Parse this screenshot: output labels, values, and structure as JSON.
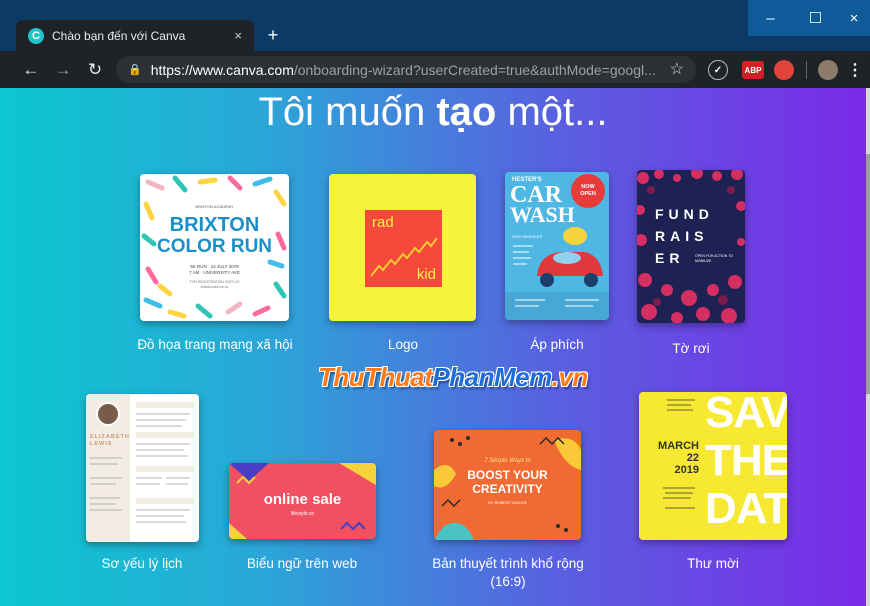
{
  "browser": {
    "tab_title": "Chào bạn đến với Canva",
    "tab_close": "×",
    "new_tab": "+",
    "url_host": "https://www.canva.com",
    "url_path": "/onboarding-wizard?userCreated=true&authMode=googl...",
    "window_min": "–",
    "window_max": "☐",
    "window_close": "×"
  },
  "page": {
    "heading_pre": "Tôi muốn ",
    "heading_bold": "tạo",
    "heading_post": " một..."
  },
  "watermark": {
    "part1": "ThuThuat",
    "part2": "PhanMem",
    "part3": ".vn"
  },
  "cards": {
    "social": {
      "label": "Đồ họa trang mạng xã hội",
      "small_top": "BRIXTON ACADEMY",
      "line1": "BRIXTON",
      "line2": "COLOR RUN",
      "meta1": "5K RUN · 22 JULY 2078",
      "meta2": "7 AM · UNIVERSITY AVE",
      "meta3": "FOR REGISTRATION VISIT US",
      "meta4": "brixtoncolorrun.co"
    },
    "logo": {
      "label": "Logo",
      "line1": "rad",
      "line2": "kid"
    },
    "poster": {
      "label": "Áp phích",
      "brand": "HESTER'S",
      "line1": "CAR",
      "line2": "WASH",
      "badge1": "NOW",
      "badge2": "OPEN",
      "small": "OUR SERVICES"
    },
    "flyer": {
      "label": "Tờ rơi",
      "line1": "FUND",
      "line2": "RAIS",
      "line3": "ER",
      "small": "OPEN FOR ACTION TO MOBILIZE"
    },
    "resume": {
      "label": "Sơ yếu lý lịch",
      "name1": "ELIZABETH",
      "name2": "LEWIS"
    },
    "banner": {
      "label": "Biểu ngữ trên web",
      "title": "online sale",
      "sub": "lifestyle.co"
    },
    "presentation": {
      "label": "Bản thuyết trình khổ rộng (16:9)",
      "small_top": "7 Simple Ways to",
      "line1": "BOOST YOUR",
      "line2": "CREATIVITY",
      "small_bottom": "BY ROBERT MILLER"
    },
    "invite": {
      "label": "Thư mời",
      "line1": "SAVE",
      "line2": "THE",
      "line3": "DATE",
      "month": "MARCH",
      "day": "22",
      "year": "2019"
    }
  }
}
